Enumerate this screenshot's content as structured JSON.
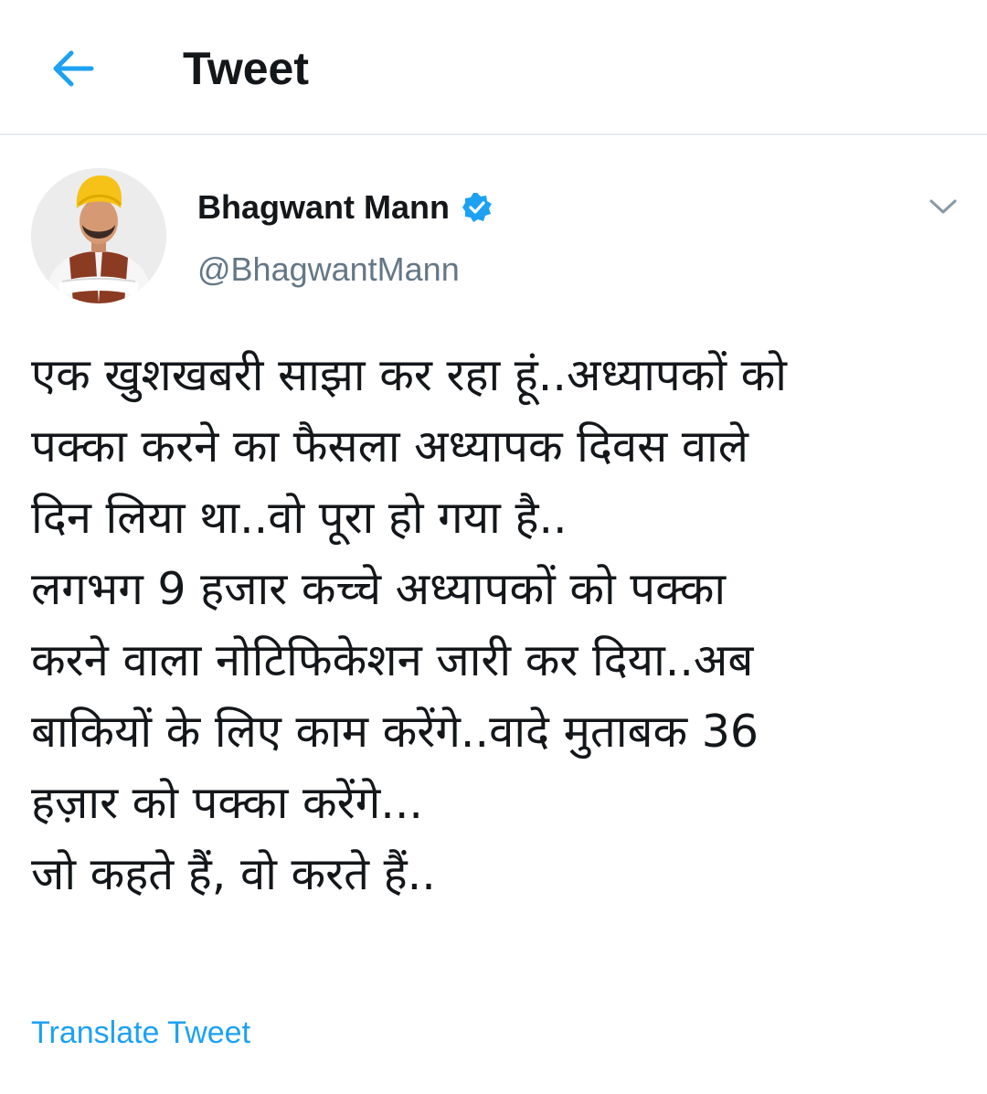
{
  "header": {
    "title": "Tweet",
    "back_icon": "arrow-left-icon"
  },
  "author": {
    "name": "Bhagwant Mann",
    "handle": "@BhagwantMann",
    "verified_icon": "verified-badge-icon"
  },
  "tweet": {
    "lines": [
      "एक खुशखबरी साझा कर रहा हूं..अध्यापकों को",
      "पक्का करने का फैसला अध्यापक दिवस वाले",
      "दिन लिया था..वो पूरा हो गया है..",
      "लगभग 9 हजार कच्चे अध्यापकों को पक्का",
      "करने वाला नोटिफिकेशन जारी कर दिया..अब",
      "बाकियों के लिए काम करेंगे..वादे मुताबक 36",
      "हज़ार को पक्का करेंगे...",
      "जो कहते हैं, वो करते हैं.."
    ]
  },
  "actions": {
    "translate_label": "Translate Tweet"
  },
  "colors": {
    "accent": "#1da1f2",
    "text": "#14171a",
    "secondary_text": "#657786",
    "divider": "#e6ecf0"
  }
}
